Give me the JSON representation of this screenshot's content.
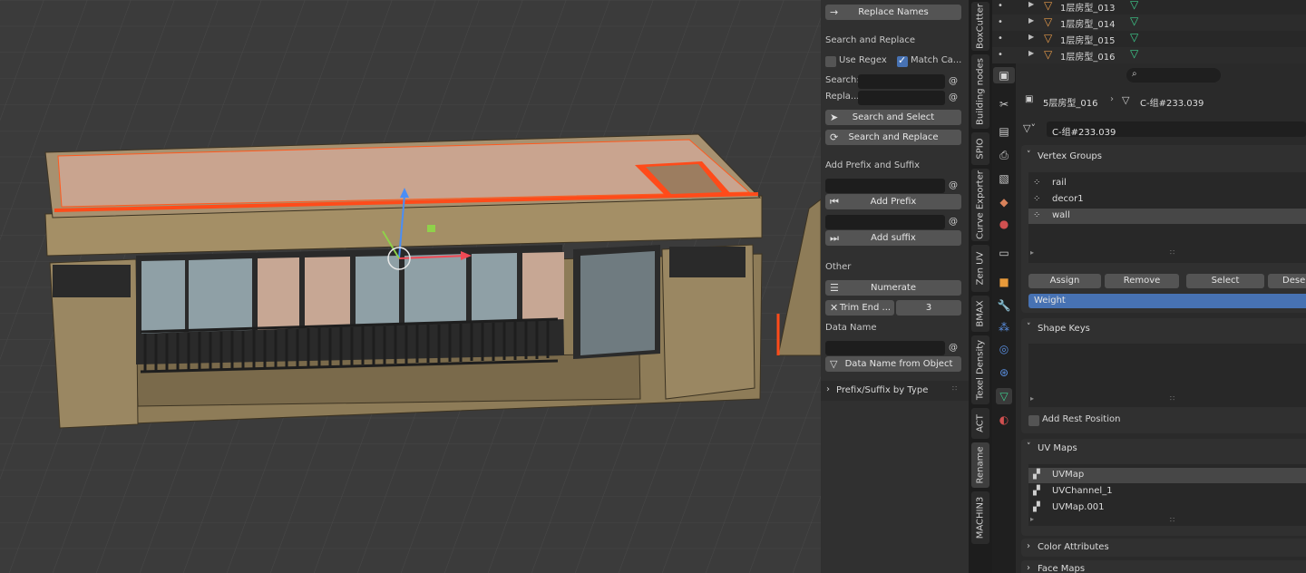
{
  "npanel": {
    "replace_names_label": "Replace Names",
    "search_replace_heading": "Search and Replace",
    "use_regex_label": "Use Regex",
    "use_regex_checked": false,
    "match_case_label": "Match Ca...",
    "match_case_checked": true,
    "search_label": "Search:",
    "replace_label": "Repla...",
    "at_symbol": "@",
    "search_and_select_label": "Search and Select",
    "search_and_replace_label": "Search and Replace",
    "prefix_suffix_heading": "Add Prefix and Suffix",
    "add_prefix_label": "Add Prefix",
    "add_suffix_label": "Add suffix",
    "other_heading": "Other",
    "numerate_label": "Numerate",
    "trim_end_label": "Trim End ...",
    "trim_end_value": "3",
    "data_name_heading": "Data Name",
    "data_name_from_object_label": "Data Name from Object",
    "prefix_suffix_by_type_label": "Prefix/Suffix by Type"
  },
  "tabs": [
    "BoxCutter",
    "Building nodes",
    "SPIO",
    "Curve Exporter",
    "Zen UV",
    "BMAX",
    "Texel Density",
    "ACT",
    "Rename",
    "MACHIN3"
  ],
  "active_tab": "Rename",
  "outliner": {
    "rows": [
      "1层房型_013",
      "1层房型_014",
      "1层房型_015",
      "1层房型_016"
    ]
  },
  "properties": {
    "breadcrumb_object": "5层房型_016",
    "breadcrumb_mesh": "C-组#233.039",
    "mesh_data_name": "C-组#233.039",
    "vertex_groups_heading": "Vertex Groups",
    "vertex_groups": [
      "rail",
      "decor1",
      "wall"
    ],
    "vertex_group_selected": "wall",
    "assign_label": "Assign",
    "remove_label": "Remove",
    "select_label": "Select",
    "deselect_label": "Desel",
    "weight_label": "Weight",
    "weight_value": "1",
    "shape_keys_heading": "Shape Keys",
    "add_rest_position_label": "Add Rest Position",
    "uv_maps_heading": "UV Maps",
    "uv_maps": [
      "UVMap",
      "UVChannel_1",
      "UVMap.001"
    ],
    "uv_map_selected": "UVMap",
    "color_attributes_heading": "Color Attributes",
    "face_maps_heading": "Face Maps"
  },
  "colors": {
    "selection_outline": "#ff5a1f",
    "accent_blue": "#4772b3",
    "mesh_green": "#3ecf8e",
    "object_orange": "#e59a4a"
  }
}
